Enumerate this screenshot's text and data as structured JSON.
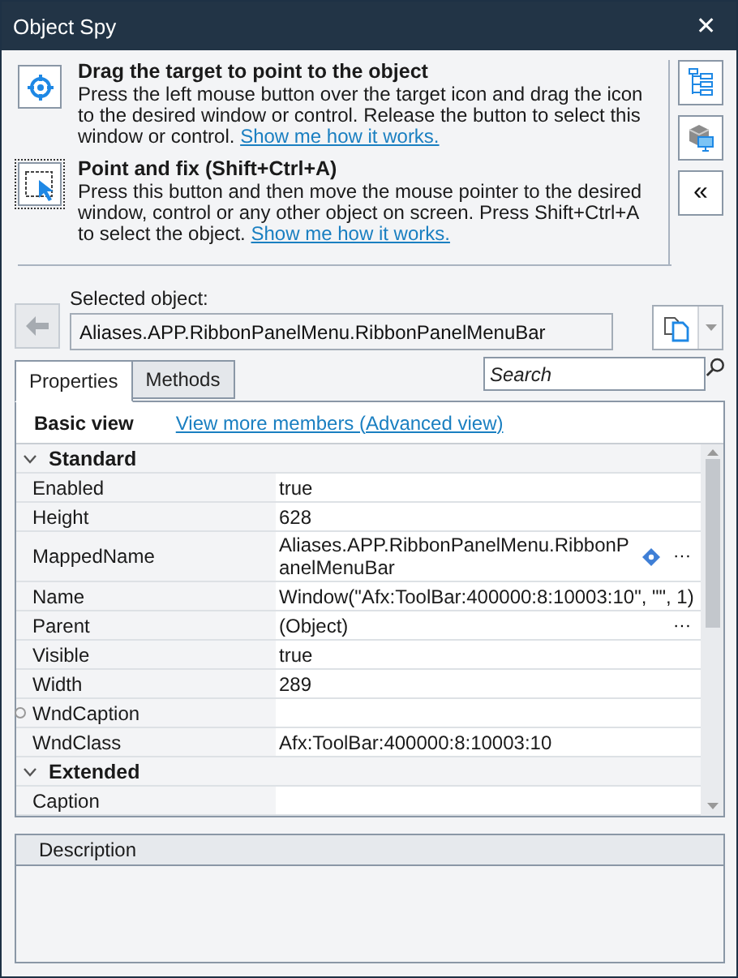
{
  "window": {
    "title": "Object Spy",
    "close": "✕"
  },
  "instructions": [
    {
      "kind": "target",
      "title": "Drag the target to point to the object",
      "text": "Press the left mouse button over the target icon and drag the icon to the desired window or control. Release the button to select this window or control.",
      "link": "Show me how it works."
    },
    {
      "kind": "pointfix",
      "title": "Point and fix (Shift+Ctrl+A)",
      "text": "Press this button and then move the mouse pointer to the desired window, control or any other object on screen. Press Shift+Ctrl+A to select the object.",
      "link": "Show me how it works."
    }
  ],
  "side_buttons": [
    {
      "kind": "tree"
    },
    {
      "kind": "browser"
    },
    {
      "kind": "text",
      "label": "«"
    }
  ],
  "selected_object": {
    "label": "Selected object:",
    "value": "Aliases.APP.RibbonPanelMenu.RibbonPanelMenuBar",
    "back_disabled": true
  },
  "tabs": [
    {
      "label": "Properties",
      "selected": true
    },
    {
      "label": "Methods",
      "selected": false
    }
  ],
  "search": {
    "placeholder": "Search"
  },
  "view": {
    "label": "Basic view",
    "link": "View more members (Advanced view)"
  },
  "groups": [
    {
      "name": "Standard",
      "expanded": true,
      "rows": [
        {
          "name": "Enabled",
          "value": "true"
        },
        {
          "name": "Height",
          "value": "628"
        },
        {
          "name": "MappedName",
          "value": "Aliases.APP.RibbonPanelMenu.RibbonPanelMenuBar",
          "mapped_icon": true,
          "action": "···"
        },
        {
          "name": "Name",
          "value": "Window(\"Afx:ToolBar:400000:8:10003:10\", \"\", 1)"
        },
        {
          "name": "Parent",
          "value": "(Object)",
          "action": "···"
        },
        {
          "name": "Visible",
          "value": "true"
        },
        {
          "name": "Width",
          "value": "289"
        },
        {
          "name": "WndCaption",
          "value": "",
          "marker": true
        },
        {
          "name": "WndClass",
          "value": "Afx:ToolBar:400000:8:10003:10"
        }
      ]
    },
    {
      "name": "Extended",
      "expanded": true,
      "rows": [
        {
          "name": "Caption",
          "value": ""
        }
      ]
    }
  ],
  "description": {
    "title": "Description"
  }
}
